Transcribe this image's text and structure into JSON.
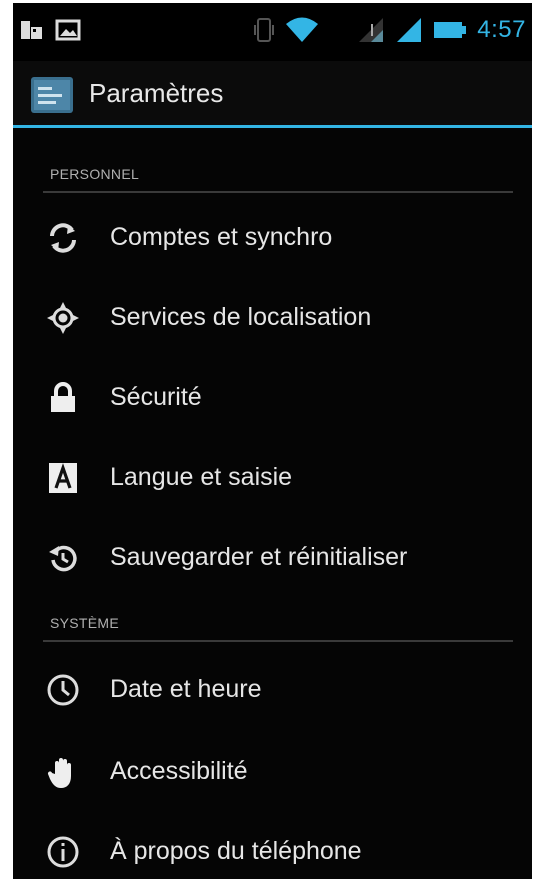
{
  "status_bar": {
    "time": "4:57",
    "icons": [
      "usb-debug-icon",
      "picture-notification-icon",
      "vibrate-icon",
      "wifi-icon",
      "signal-icon",
      "signal-icon",
      "battery-icon"
    ]
  },
  "action_bar": {
    "title": "Paramètres",
    "icon": "settings-app-icon"
  },
  "colors": {
    "accent": "#33b5e5",
    "background": "#050505",
    "text": "#e6e6e6",
    "section_text": "#b0b0b0"
  },
  "sections": [
    {
      "header": "PERSONNEL",
      "items": [
        {
          "label": "Comptes et synchro",
          "icon": "sync-icon"
        },
        {
          "label": "Services de localisation",
          "icon": "location-icon"
        },
        {
          "label": "Sécurité",
          "icon": "lock-icon"
        },
        {
          "label": "Langue et saisie",
          "icon": "language-icon"
        },
        {
          "label": "Sauvegarder et réinitialiser",
          "icon": "backup-restore-icon"
        }
      ]
    },
    {
      "header": "SYSTÈME",
      "items": [
        {
          "label": "Date et heure",
          "icon": "clock-icon"
        },
        {
          "label": "Accessibilité",
          "icon": "hand-icon"
        },
        {
          "label": "À propos du téléphone",
          "icon": "info-icon"
        }
      ]
    }
  ]
}
